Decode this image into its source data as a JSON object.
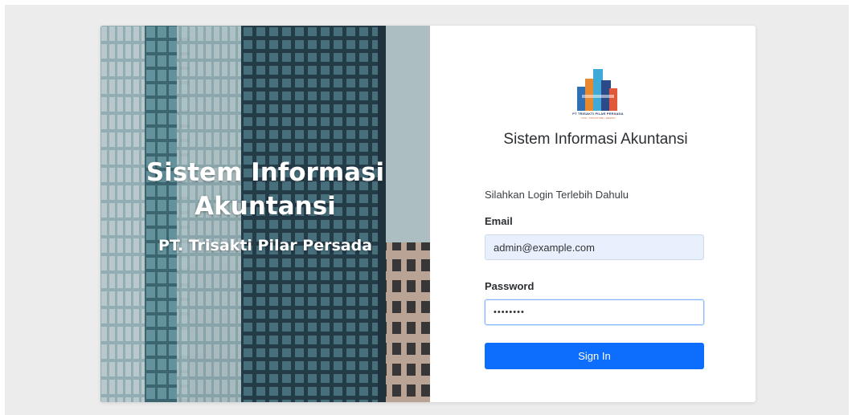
{
  "hero": {
    "title_line1": "Sistem Informasi",
    "title_line2": "Akuntansi",
    "subtitle": "PT. Trisakti Pilar Persada"
  },
  "logo": {
    "company_name": "PT TRISAKTI PILAR PERSADA",
    "tagline": "CIVIL • STRUCTURE • DESIGN"
  },
  "app_title": "Sistem Informasi Akuntansi",
  "form": {
    "hint": "Silahkan Login Terlebih Dahulu",
    "email_label": "Email",
    "email_value": "admin@example.com",
    "password_label": "Password",
    "password_value": "password",
    "submit_label": "Sign In"
  },
  "colors": {
    "primary": "#0d6efd",
    "page_bg": "#ececec",
    "email_autofill_bg": "#e8f0fe"
  }
}
